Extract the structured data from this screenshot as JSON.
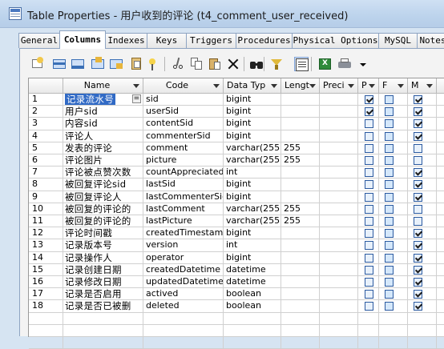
{
  "window": {
    "title": "Table Properties - 用户收到的评论 (t4_comment_user_received)"
  },
  "tabs": [
    {
      "label": "General"
    },
    {
      "label": "Columns",
      "active": true
    },
    {
      "label": "Indexes"
    },
    {
      "label": "Keys"
    },
    {
      "label": "Triggers"
    },
    {
      "label": "Procedures"
    },
    {
      "label": "Physical Options"
    },
    {
      "label": "MySQL"
    },
    {
      "label": "Notes"
    }
  ],
  "toolbar": {
    "icons": [
      "properties-icon",
      "insert-row-icon",
      "add-row-icon",
      "insert-from-icon",
      "add-from-icon",
      "paste-column-icon",
      "auto-fill-icon",
      "cut-icon",
      "copy-icon",
      "paste-icon",
      "delete-icon",
      "find-icon",
      "filter-icon",
      "customize-columns-icon",
      "excel-export-icon",
      "print-icon",
      "dropdown-arrow-icon"
    ]
  },
  "grid": {
    "headers": {
      "name": "Name",
      "code": "Code",
      "data_type": "Data Typ",
      "length": "Lengt",
      "precision": "Preci",
      "p": "P",
      "f": "F",
      "m": "M"
    },
    "rows": [
      {
        "num": "1",
        "name": "记录流水号",
        "code": "sid",
        "type": "bigint",
        "length": "",
        "p": true,
        "f": false,
        "m": true
      },
      {
        "num": "2",
        "name": "用户sid",
        "code": "userSid",
        "type": "bigint",
        "length": "",
        "p": true,
        "f": false,
        "m": true
      },
      {
        "num": "3",
        "name": "内容sid",
        "code": "contentSid",
        "type": "bigint",
        "length": "",
        "p": false,
        "f": false,
        "m": true
      },
      {
        "num": "4",
        "name": "评论人",
        "code": "commenterSid",
        "type": "bigint",
        "length": "",
        "p": false,
        "f": false,
        "m": true
      },
      {
        "num": "5",
        "name": "发表的评论",
        "code": "comment",
        "type": "varchar(255)",
        "length": "255",
        "p": false,
        "f": false,
        "m": false
      },
      {
        "num": "6",
        "name": "评论图片",
        "code": "picture",
        "type": "varchar(255)",
        "length": "255",
        "p": false,
        "f": false,
        "m": false
      },
      {
        "num": "7",
        "name": "评论被点赞次数",
        "code": "countAppreciated",
        "type": "int",
        "length": "",
        "p": false,
        "f": false,
        "m": true
      },
      {
        "num": "8",
        "name": "被回复评论sid",
        "code": "lastSid",
        "type": "bigint",
        "length": "",
        "p": false,
        "f": false,
        "m": true
      },
      {
        "num": "9",
        "name": "被回复评论人",
        "code": "lastCommenterSid",
        "type": "bigint",
        "length": "",
        "p": false,
        "f": false,
        "m": true
      },
      {
        "num": "10",
        "name": "被回复的评论的",
        "code": "lastComment",
        "type": "varchar(255)",
        "length": "255",
        "p": false,
        "f": false,
        "m": false
      },
      {
        "num": "11",
        "name": "被回复的评论的",
        "code": "lastPicture",
        "type": "varchar(255)",
        "length": "255",
        "p": false,
        "f": false,
        "m": false
      },
      {
        "num": "12",
        "name": "评论时间戳",
        "code": "createdTimestamp",
        "type": "bigint",
        "length": "",
        "p": false,
        "f": false,
        "m": true
      },
      {
        "num": "13",
        "name": "记录版本号",
        "code": "version",
        "type": "int",
        "length": "",
        "p": false,
        "f": false,
        "m": true
      },
      {
        "num": "14",
        "name": "记录操作人",
        "code": "operator",
        "type": "bigint",
        "length": "",
        "p": false,
        "f": false,
        "m": true
      },
      {
        "num": "15",
        "name": "记录创建日期",
        "code": "createdDatetime",
        "type": "datetime",
        "length": "",
        "p": false,
        "f": false,
        "m": true
      },
      {
        "num": "16",
        "name": "记录修改日期",
        "code": "updatedDatetime",
        "type": "datetime",
        "length": "",
        "p": false,
        "f": false,
        "m": true
      },
      {
        "num": "17",
        "name": "记录是否启用",
        "code": "actived",
        "type": "boolean",
        "length": "",
        "p": false,
        "f": false,
        "m": true
      },
      {
        "num": "18",
        "name": "记录是否已被删",
        "code": "deleted",
        "type": "boolean",
        "length": "",
        "p": false,
        "f": false,
        "m": true
      }
    ],
    "empty_rows": 3,
    "selected_row_index": 0,
    "edit_button_label": "="
  },
  "colors": {
    "selection": "#316ac5",
    "titlebar": "#bcd3ec",
    "checkbox_border": "#2b5aa0"
  }
}
